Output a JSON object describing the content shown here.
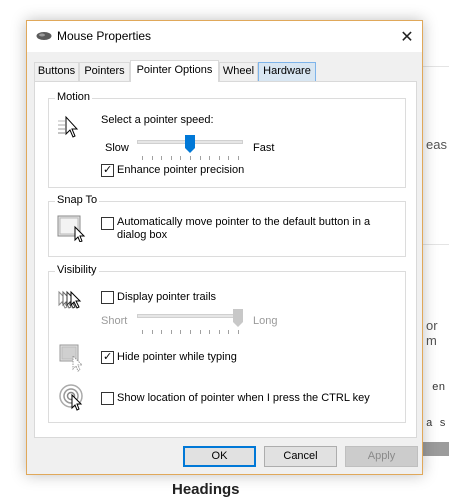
{
  "background": {
    "fragment_1": "eas",
    "fragment_2": "or m",
    "code_1": "en",
    "code_2": "a s",
    "heading": "Headings"
  },
  "window": {
    "title": "Mouse Properties",
    "close_glyph": "✕"
  },
  "tabs": [
    {
      "label": "Buttons"
    },
    {
      "label": "Pointers"
    },
    {
      "label": "Pointer Options"
    },
    {
      "label": "Wheel"
    },
    {
      "label": "Hardware"
    }
  ],
  "motion": {
    "group_label": "Motion",
    "speed_label": "Select a pointer speed:",
    "slow_label": "Slow",
    "fast_label": "Fast",
    "speed_value_fraction": 0.5,
    "enhance_label": "Enhance pointer precision",
    "enhance_checked": true
  },
  "snap_to": {
    "group_label": "Snap To",
    "auto_move_label_line1": "Automatically move pointer to the default button in a",
    "auto_move_label_line2": "dialog box",
    "auto_move_checked": false
  },
  "visibility": {
    "group_label": "Visibility",
    "trails_label": "Display pointer trails",
    "trails_checked": false,
    "short_label": "Short",
    "long_label": "Long",
    "trail_length_fraction": 1.0,
    "hide_label": "Hide pointer while typing",
    "hide_checked": true,
    "show_ctrl_label": "Show location of pointer when I press the CTRL key",
    "show_ctrl_checked": false
  },
  "buttons": {
    "ok": "OK",
    "cancel": "Cancel",
    "apply": "Apply"
  },
  "colors": {
    "accent": "#0078d7",
    "dialog_border": "#e0a85a"
  }
}
